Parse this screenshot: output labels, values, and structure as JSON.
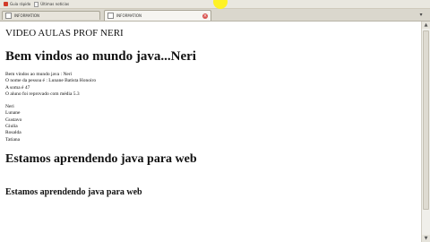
{
  "bookmarks": {
    "items": [
      {
        "label": "Guia rápido",
        "icon": "red-square-icon"
      },
      {
        "label": "Últimas notícias",
        "icon": "page-icon"
      }
    ]
  },
  "tabs": [
    {
      "label": "INFORMATION",
      "active": false
    },
    {
      "label": "INFORMATION",
      "active": true
    }
  ],
  "page": {
    "site_title": "VIDEO AULAS PROF NERI",
    "heading": "Bem vindos ao mundo java...Neri",
    "lines": [
      "Bem vindos ao mundo java : Neri",
      "O nome da pessoa é : Lunane Batista Honoiro",
      "A soma é 47",
      "O aluno foi reprovado com média 5.3"
    ],
    "names": [
      "Neri",
      "Lunane",
      "Gustavo",
      "Giulia",
      "Rosalda",
      "Tatiana"
    ],
    "section_heading_1": "Estamos aprendendo java para web",
    "section_heading_2": "Estamos aprendendo java para web"
  },
  "colors": {
    "highlight": "#fff21a",
    "tab_close": "#d9534f"
  }
}
